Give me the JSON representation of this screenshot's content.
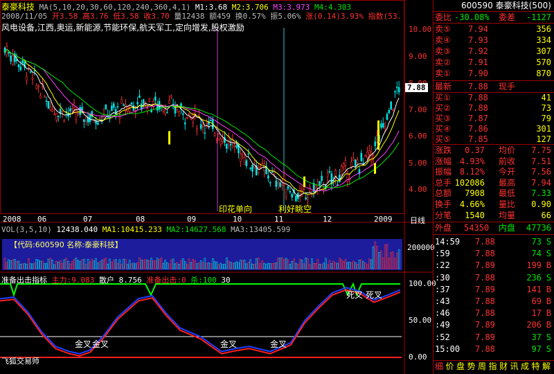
{
  "stock": {
    "name": "泰豪科技",
    "code": "600590",
    "title": "600590 泰豪科技(500)",
    "date": "2008/11/05"
  },
  "quote_line": {
    "open": "开3.58",
    "high": "高3.76",
    "low": "低3.58",
    "close": "收3.70",
    "vol": "量12438",
    "amount": "额459",
    "turnover": "换0.57%",
    "amplitude": "振5.06%",
    "change": "涨(0.14)3.93%",
    "index": "指数(53."
  },
  "ma_line": {
    "label": "MA(5,10,20,30,60,120,240,360,4,1)",
    "m1": "M1:3.68",
    "m2": "M2:3.706",
    "m3": "M3:3.973",
    "m4": "M4:4.303"
  },
  "concepts": "风电设备,江西,奥运,新能源,节能环保,航天军工,定向增发,股权激励",
  "price_axis": [
    "10.00",
    "9.00",
    "8.00",
    "7.00",
    "6.00",
    "5.00",
    "4.00"
  ],
  "last_price_tag": "7.88",
  "time_axis": [
    "2008",
    "06",
    "07",
    "08",
    "09",
    "10",
    "11",
    "12",
    "2009"
  ],
  "period": "日线",
  "events": [
    "印花单向",
    "利好眺空"
  ],
  "vol_line": {
    "label": "VOL(3,5,10)",
    "v": "12438.040",
    "ma1": "MA1:10415.233",
    "ma2": "MA2:14627.568",
    "ma3": "MA3:13405.599"
  },
  "vol_header": "【代码:600590 名称:泰豪科技】",
  "vol_axis": "200000",
  "ind_line": {
    "label": "准备出击指标",
    "zl": "主力:9.083",
    "sh": "散户 8.756",
    "zb": "准备出击:0",
    "sha": "杀:100",
    "n": "30"
  },
  "ind_axis": [
    "100.00",
    "50.00",
    "0.00"
  ],
  "cross_labels": [
    "金叉",
    "金叉",
    "金叉",
    "金叉",
    "死叉",
    "死叉"
  ],
  "watermark": "飞狐交易师",
  "ratio": {
    "l1": "委比",
    "v1": "-30.08%",
    "l2": "委差",
    "v2": "-1127"
  },
  "asks": [
    {
      "l": "卖⑤",
      "p": "7.94",
      "v": "356"
    },
    {
      "l": "卖④",
      "p": "7.93",
      "v": "334"
    },
    {
      "l": "卖③",
      "p": "7.92",
      "v": "307"
    },
    {
      "l": "卖②",
      "p": "7.91",
      "v": "570"
    },
    {
      "l": "卖①",
      "p": "7.90",
      "v": "870"
    }
  ],
  "last": {
    "l": "最新",
    "p": "7.88",
    "l2": "现手"
  },
  "bids": [
    {
      "l": "买①",
      "p": "7.88",
      "v": "41"
    },
    {
      "l": "买②",
      "p": "7.88",
      "v": "73"
    },
    {
      "l": "买③",
      "p": "7.87",
      "v": "79"
    },
    {
      "l": "买④",
      "p": "7.86",
      "v": "301"
    },
    {
      "l": "买⑤",
      "p": "7.85",
      "v": "127"
    }
  ],
  "stats": [
    {
      "l1": "涨跌",
      "v1": "0.37",
      "l2": "均价",
      "v2": "7.75"
    },
    {
      "l1": "涨幅",
      "v1": "4.93%",
      "l2": "前收",
      "v2": "7.51"
    },
    {
      "l1": "振幅",
      "v1": "8.12%",
      "l2": "今开",
      "v2": "7.56"
    },
    {
      "l1": "总手",
      "v1": "102086",
      "l2": "最高",
      "v2": "7.94"
    },
    {
      "l1": "总额",
      "v1": "7908",
      "l2": "最低",
      "v2": "7.33"
    },
    {
      "l1": "换手",
      "v1": "4.66%",
      "l2": "量比",
      "v2": "0.90"
    },
    {
      "l1": "分笔",
      "v1": "1540",
      "l2": "均量",
      "v2": "66"
    }
  ],
  "outer": {
    "l1": "外盘",
    "v1": "54350",
    "l2": "内盘",
    "v2": "47736"
  },
  "ticks": [
    {
      "t": "14:59",
      "p": "7.88",
      "v": "73",
      "s": "S"
    },
    {
      "t": ":59",
      "p": "7.88",
      "v": "74",
      "s": "S"
    },
    {
      "t": ":22",
      "p": "7.89",
      "v": "199",
      "s": "B"
    },
    {
      "t": ":30",
      "p": "7.88",
      "v": "236",
      "s": "S"
    },
    {
      "t": ":37",
      "p": "7.89",
      "v": "141",
      "s": "B"
    },
    {
      "t": ":43",
      "p": "7.88",
      "v": "69",
      "s": "B"
    },
    {
      "t": ":46",
      "p": "7.88",
      "v": "17",
      "s": "B"
    },
    {
      "t": ":49",
      "p": "7.89",
      "v": "206",
      "s": "B"
    },
    {
      "t": ":52",
      "p": "7.89",
      "v": "37",
      "s": "S"
    },
    {
      "t": "15:00",
      "p": "7.88",
      "v": "97",
      "s": "S"
    }
  ],
  "bottom_tabs": [
    "细",
    "价",
    "盘",
    "势",
    "周",
    "指",
    "财",
    "讯",
    "成",
    "特",
    "解"
  ],
  "colors": {
    "up": "#ff3232",
    "down": "#00e600",
    "accent": "#ffff00",
    "bg": "#000000"
  }
}
